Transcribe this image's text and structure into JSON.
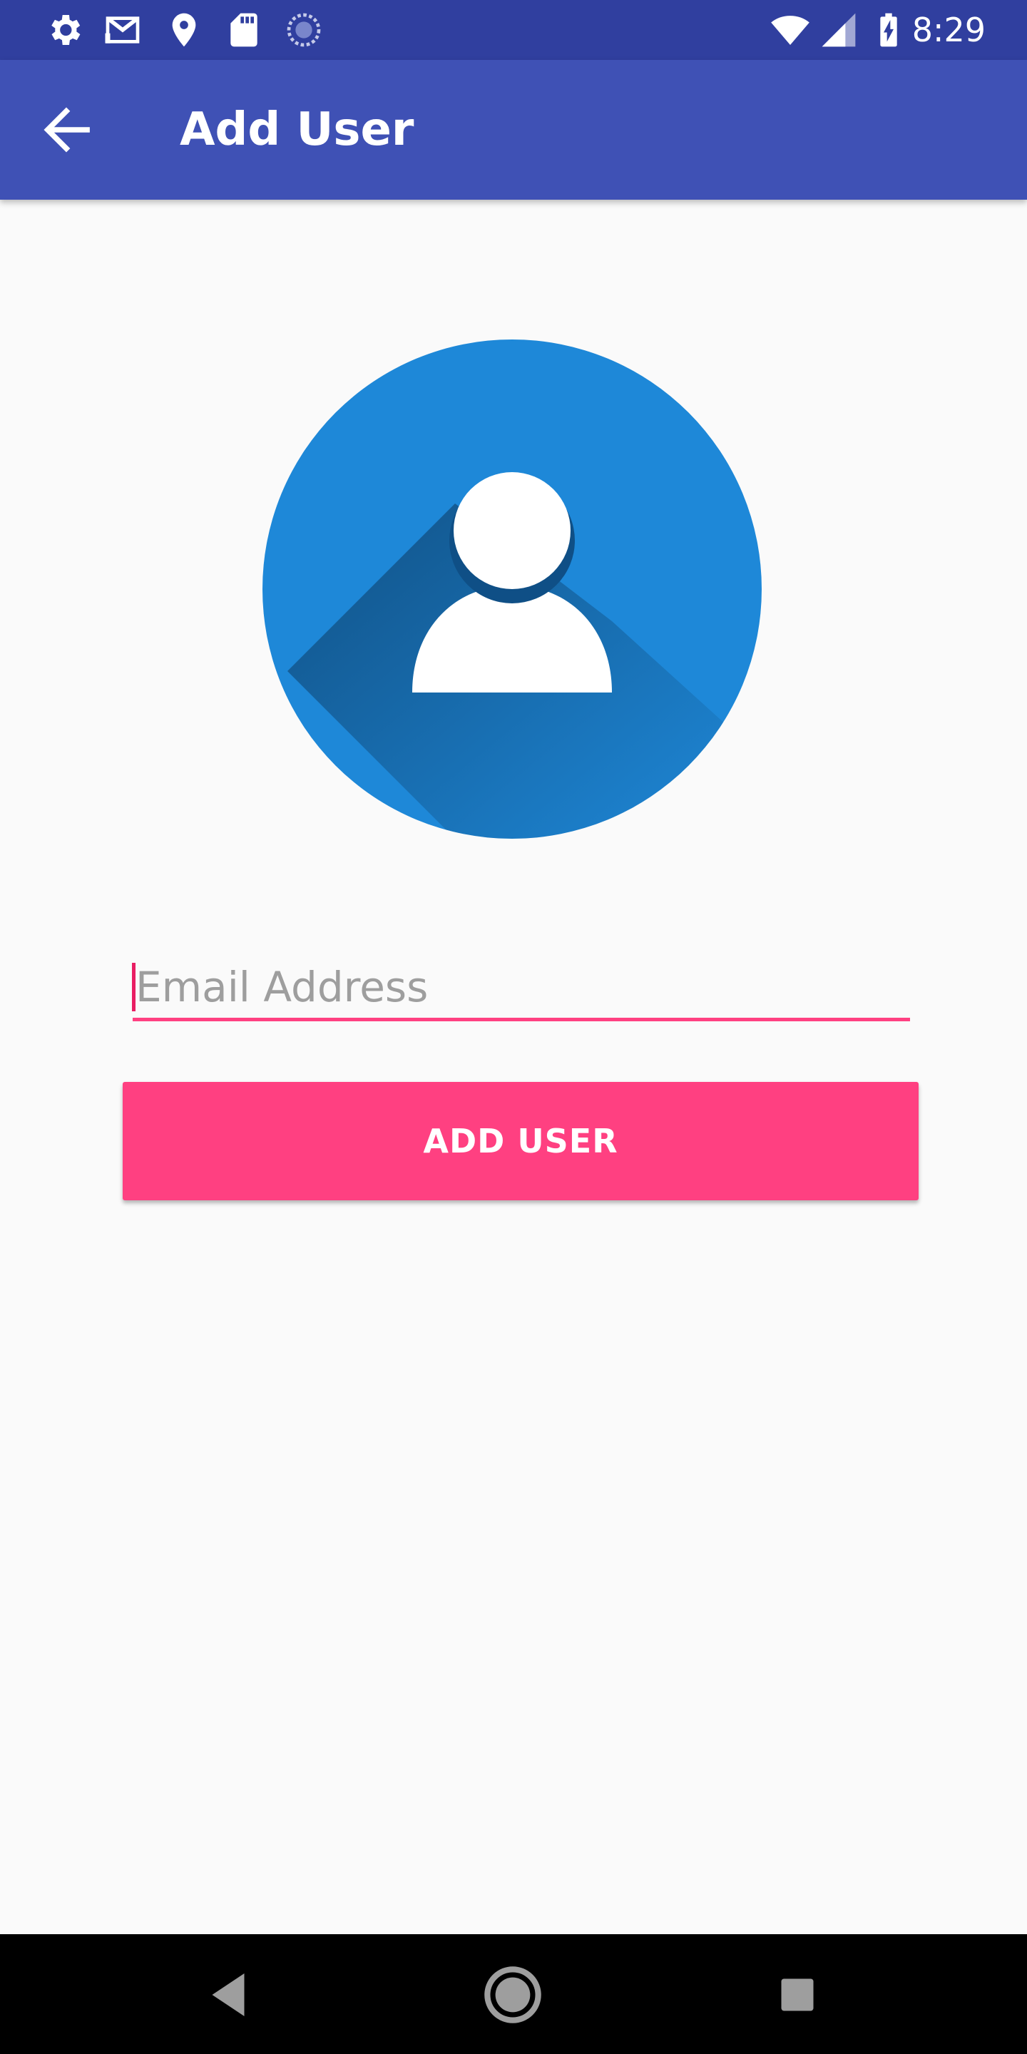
{
  "status_bar": {
    "time": "8:29",
    "icons": [
      "settings-icon",
      "gmail-icon",
      "location-icon",
      "sd-card-icon",
      "sync-icon",
      "wifi-icon",
      "signal-icon",
      "battery-charging-icon"
    ]
  },
  "app_bar": {
    "title": "Add User",
    "back_icon": "arrow-back-icon"
  },
  "avatar": {
    "icon": "user-avatar-icon",
    "circle_color": "#1e88d8"
  },
  "form": {
    "email_placeholder": "Email Address",
    "email_value": "",
    "submit_label": "ADD USER"
  },
  "nav_bar": {
    "buttons": [
      "back-triangle-icon",
      "home-circle-icon",
      "recents-square-icon"
    ]
  },
  "colors": {
    "status_bar": "#303f9f",
    "primary": "#3f51b5",
    "accent": "#ff4081",
    "background": "#fafafa"
  }
}
